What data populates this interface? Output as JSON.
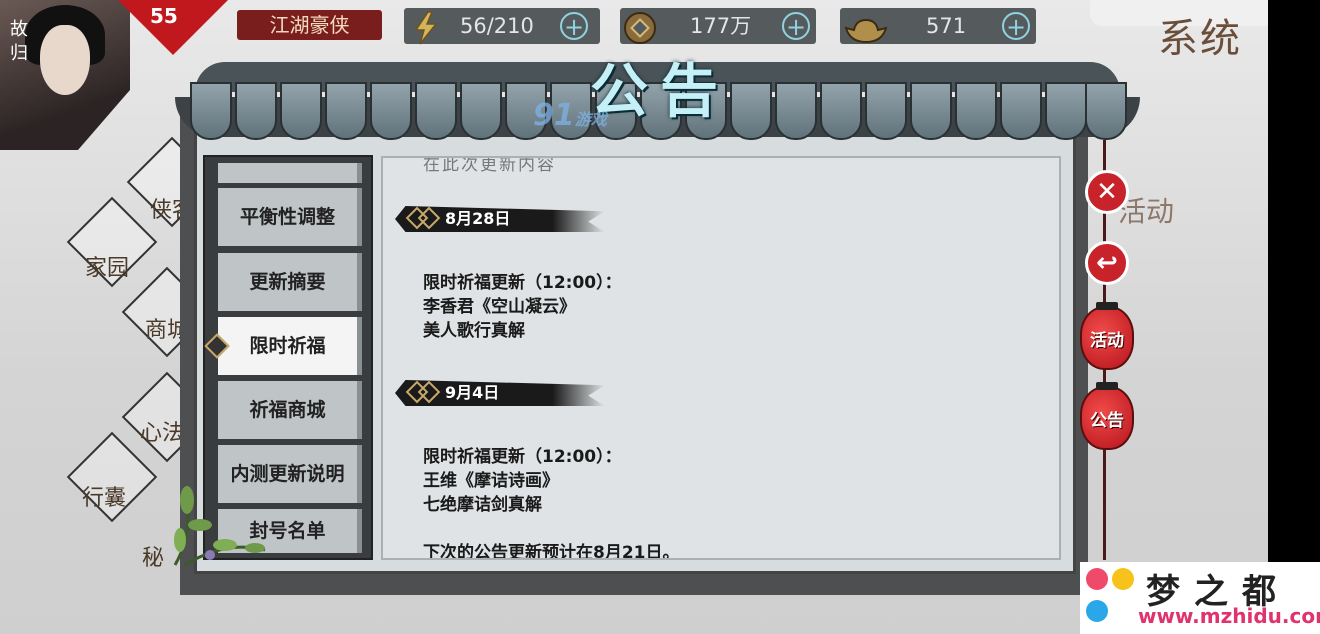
{
  "hud": {
    "home_label": "故归",
    "level": "55",
    "title": "江湖豪侠",
    "energy": "56/210",
    "coins": "177万",
    "ingots": "571",
    "plus": "+",
    "system_label": "系统"
  },
  "map_nodes": [
    "侠客",
    "家园",
    "商城",
    "心法",
    "行囊",
    "秘"
  ],
  "dialog": {
    "title": "公告",
    "watermark": "91",
    "watermark_sub": "游戏"
  },
  "menu": {
    "items": [
      {
        "label": "平衡性调整",
        "active": false
      },
      {
        "label": "更新摘要",
        "active": false
      },
      {
        "label": "限时祈福",
        "active": true
      },
      {
        "label": "祈福商城",
        "active": false
      },
      {
        "label": "内测更新说明",
        "active": false
      },
      {
        "label": "封号名单",
        "active": false
      }
    ]
  },
  "content": {
    "cutoff_text": "在此次更新内容",
    "sections": [
      {
        "date": "8月28日",
        "lines": [
          "限时祈福更新（12:00）：",
          "李香君《空山凝云》",
          "美人歌行真解"
        ]
      },
      {
        "date": "9月4日",
        "lines": [
          "限时祈福更新（12:00）：",
          "王维《摩诘诗画》",
          "七绝摩诘剑真解"
        ]
      }
    ],
    "footer": "下次的公告更新预计在8月21日。"
  },
  "side_buttons": {
    "close": "✕",
    "back": "↩",
    "event": "活动",
    "notice": "公告",
    "event_bg_label": "活动"
  },
  "logo": {
    "name": "梦之都",
    "url": "www.mzhidu.com"
  },
  "colors": {
    "accent_red": "#c8232a",
    "title_cyan": "#c5f0f7",
    "logo_pink": "#e0336e"
  }
}
